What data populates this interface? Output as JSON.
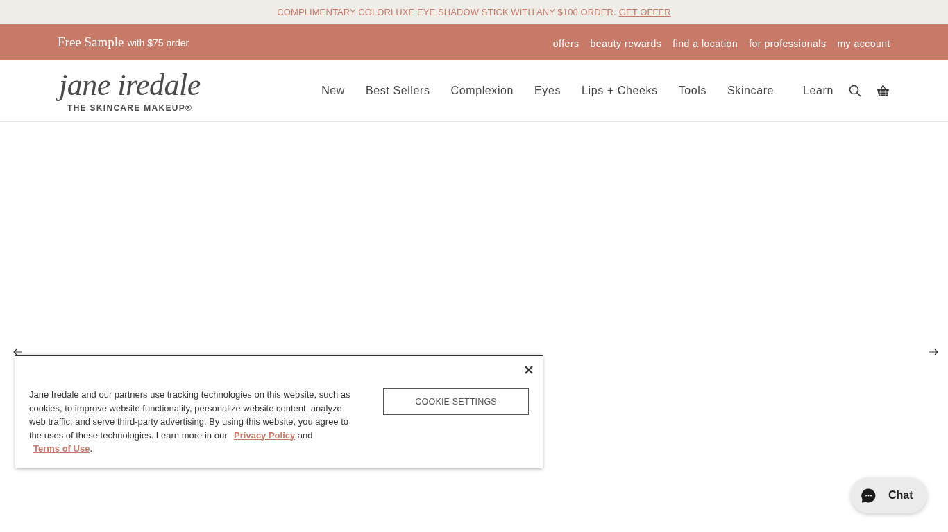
{
  "promo_bar": {
    "text": "COMPLIMENTARY COLORLUXE EYE SHADOW STICK WITH ANY $100 ORDER.",
    "link": "GET OFFER"
  },
  "utility_bar": {
    "sample_title": "Free Sample",
    "sample_note": "with $75 order",
    "links": [
      "offers",
      "beauty rewards",
      "find a location",
      "for professionals",
      "my account"
    ]
  },
  "header": {
    "logo": {
      "wordmark": "jane iredale",
      "tagline": "THE SKINCARE MAKEUP®"
    },
    "nav": [
      "New",
      "Best Sellers",
      "Complexion",
      "Eyes",
      "Lips + Cheeks",
      "Tools",
      "Skincare",
      "Learn"
    ]
  },
  "cookie_banner": {
    "text": "Jane Iredale and our partners use tracking technologies on this website, such as cookies, to improve website functionality, personalize website content, analyze web traffic, and serve third-party advertising. By using this website, you agree to the uses of these technologies. Learn more in our",
    "privacy_link": "Privacy Policy",
    "joiner": "and",
    "terms_link": "Terms of Use",
    "end": ".",
    "button": "COOKIE SETTINGS"
  },
  "chat": {
    "label": "Chat"
  }
}
